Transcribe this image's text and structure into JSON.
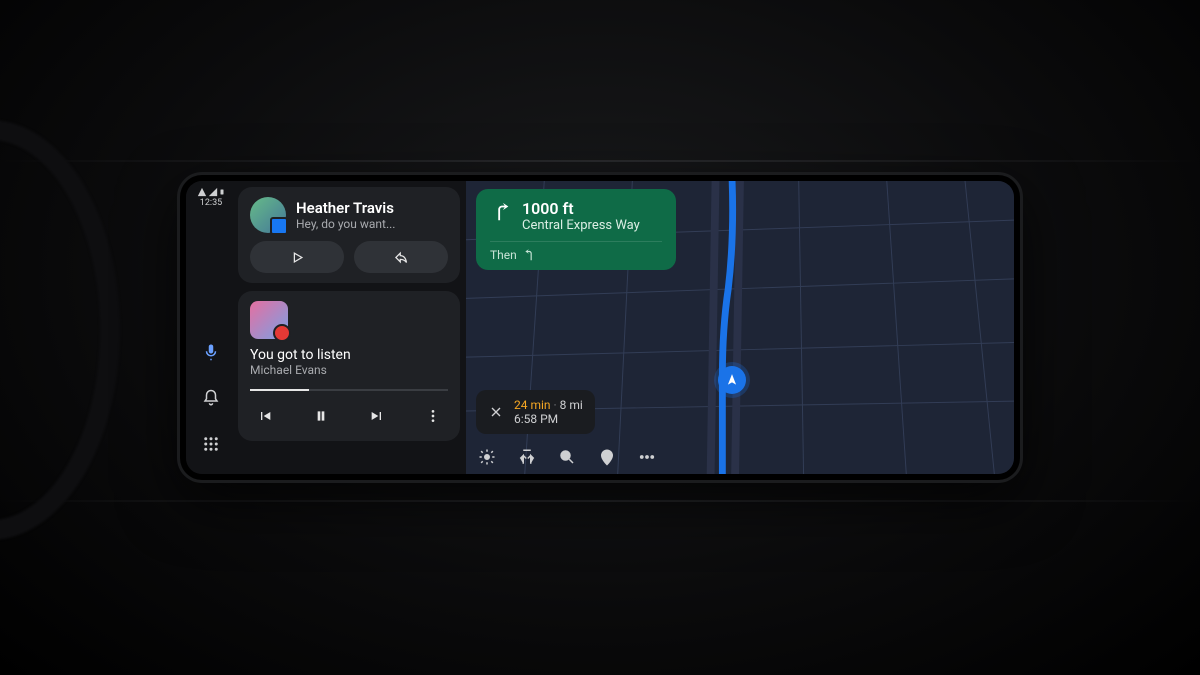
{
  "status": {
    "time": "12:35"
  },
  "message": {
    "sender": "Heather Travis",
    "preview": "Hey, do you want..."
  },
  "media": {
    "title": "You got to listen",
    "artist": "Michael Evans"
  },
  "navigation": {
    "distance": "1000 ft",
    "road": "Central Express Way",
    "then_label": "Then"
  },
  "eta": {
    "duration": "24 min",
    "distance": "8 mi",
    "arrival": "6:58 PM"
  },
  "colors": {
    "nav_card": "#0f6b47",
    "route": "#1a73e8",
    "eta_duration": "#f5a623"
  }
}
